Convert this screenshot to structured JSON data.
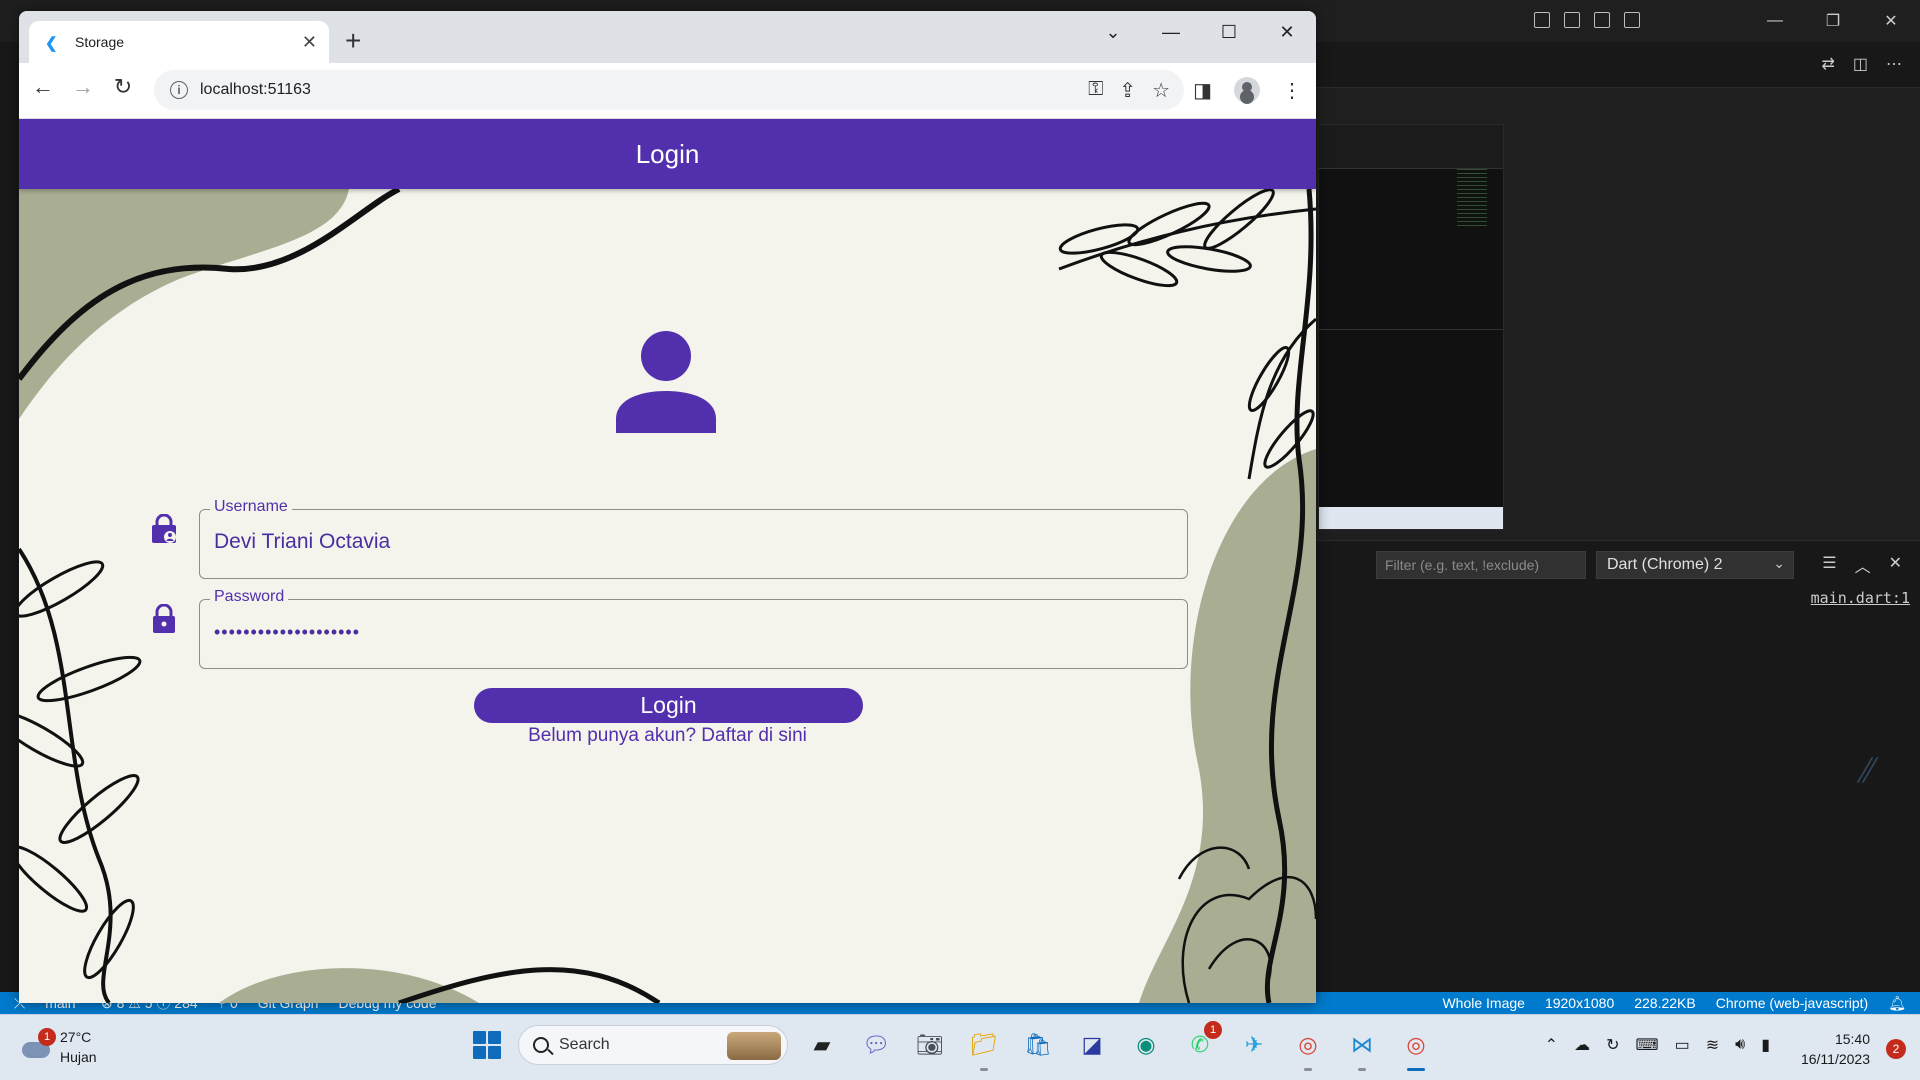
{
  "browser": {
    "tab_title": "Storage",
    "url": "localhost:51163",
    "new_tab_glyph": "+",
    "favicon": "flutter-icon"
  },
  "app": {
    "appbar_title": "Login",
    "username_label": "Username",
    "username_value": "Devi Triani Octavia",
    "password_label": "Password",
    "password_value": "••••••••••••••••••••",
    "login_button": "Login",
    "register_link": "Belum punya akun? Daftar di sini",
    "colors": {
      "primary": "#5230ad",
      "background": "#f4f3ec",
      "leaf_green": "#a9ad92"
    }
  },
  "vscode": {
    "filter_placeholder": "Filter (e.g. text, !exclude)",
    "debug_target": "Dart (Chrome) 2",
    "output_link": "main.dart:1",
    "statusbar": {
      "branch": "main*",
      "problems": "⊗ 8 ⚠ 5 ⓘ 284",
      "ports": "⑂ 0",
      "git_graph": "Git Graph",
      "debug": "Debug my code",
      "whole_image": "Whole Image",
      "resolution": "1920x1080",
      "size": "228.22KB",
      "runtime": "Chrome (web-javascript)"
    },
    "accent": "#007acc"
  },
  "taskbar": {
    "weather_temp": "27°C",
    "weather_desc": "Hujan",
    "weather_badge": "1",
    "search_label": "Search",
    "whatsapp_badge": "1",
    "time": "15:40",
    "date": "16/11/2023",
    "notification_count": "2"
  }
}
